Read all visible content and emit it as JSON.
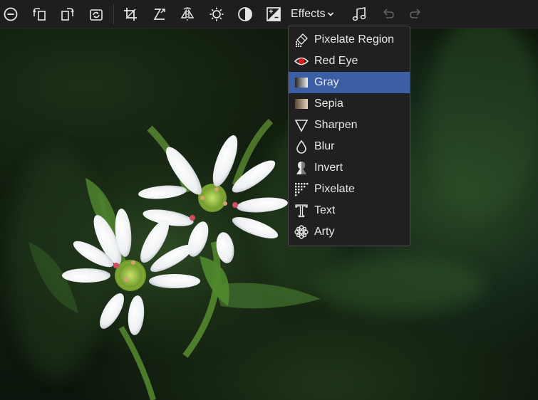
{
  "toolbar": {
    "effects_label": "Effects",
    "buttons": [
      {
        "icon": "zoom-out-icon"
      },
      {
        "icon": "rotate-left-icon"
      },
      {
        "icon": "rotate-right-icon"
      },
      {
        "icon": "refresh-icon"
      },
      {
        "icon": "crop-icon"
      },
      {
        "icon": "resize-icon"
      },
      {
        "icon": "flip-icon"
      },
      {
        "icon": "brightness-icon"
      },
      {
        "icon": "contrast-icon"
      },
      {
        "icon": "exposure-icon"
      },
      {
        "icon": "music-note-icon"
      },
      {
        "icon": "undo-icon"
      },
      {
        "icon": "redo-icon"
      }
    ]
  },
  "effects_menu": {
    "selected": "Gray",
    "items": [
      {
        "label": "Pixelate Region",
        "icon": "pixelate-region-icon"
      },
      {
        "label": "Red Eye",
        "icon": "red-eye-icon"
      },
      {
        "label": "Gray",
        "icon": "gray-gradient-icon"
      },
      {
        "label": "Sepia",
        "icon": "sepia-gradient-icon"
      },
      {
        "label": "Sharpen",
        "icon": "sharpen-triangle-icon"
      },
      {
        "label": "Blur",
        "icon": "blur-drop-icon"
      },
      {
        "label": "Invert",
        "icon": "invert-silhouette-icon"
      },
      {
        "label": "Pixelate",
        "icon": "pixelate-icon"
      },
      {
        "label": "Text",
        "icon": "text-icon"
      },
      {
        "label": "Arty",
        "icon": "arty-flower-icon"
      }
    ]
  },
  "colors": {
    "toolbar_bg": "#1e1e1e",
    "menu_bg": "#202020",
    "menu_selected": "#3b5ea4",
    "icon": "#e6e6e6",
    "red_eye": "#e01c1c"
  }
}
